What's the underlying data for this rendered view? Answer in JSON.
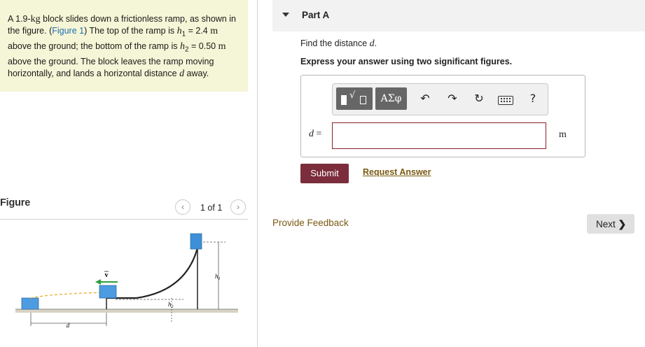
{
  "problem": {
    "p1": "A 1.9-",
    "kg_unit": "kg",
    "p2": " block slides down a frictionless ramp, as shown in the figure. (",
    "figure_link": "Figure 1",
    "p3": ") The top of the ramp is ",
    "h1_sym": "h",
    "h1_sub": "1",
    "p4": " = 2.4 ",
    "m1": "m",
    "p5": " above the ground; the bottom of the ramp is ",
    "h2_sym": "h",
    "h2_sub": "2",
    "p6": " = 0.50 ",
    "m2": "m",
    "p7": " above the ground. The block leaves the ramp moving horizontally, and lands a horizontal distance ",
    "d_sym": "d",
    "p8": " away."
  },
  "figure": {
    "title": "Figure",
    "pager": "1 of 1",
    "prev_glyph": "‹",
    "next_glyph": "›",
    "labels": {
      "v": "v",
      "h1": "h",
      "h1_sub": "1",
      "h2": "h",
      "h2_sub": "2",
      "d": "d"
    }
  },
  "part": {
    "title": "Part A",
    "question_prefix": "Find the distance ",
    "question_var": "d",
    "question_suffix": ".",
    "instruction": "Express your answer using two significant figures.",
    "toolbar": {
      "symbols_label": "ΑΣφ",
      "radical_glyph": "√",
      "undo_glyph": "↶",
      "redo_glyph": "↷",
      "reset_glyph": "↻",
      "help_label": "?"
    },
    "var_label": "d",
    "equals": " =",
    "answer_value": "",
    "unit": "m",
    "submit_label": "Submit",
    "request_label": "Request Answer"
  },
  "feedback_label": "Provide Feedback",
  "next_label": "Next",
  "next_glyph": "❯",
  "colors": {
    "problem_bg": "#f5f5d7",
    "submit_bg": "#7b2d3b",
    "link": "#7a5a14",
    "figure_link": "#1f6fb0",
    "arrow_green": "#2e9e3e",
    "block_blue": "#3d8fd8"
  }
}
